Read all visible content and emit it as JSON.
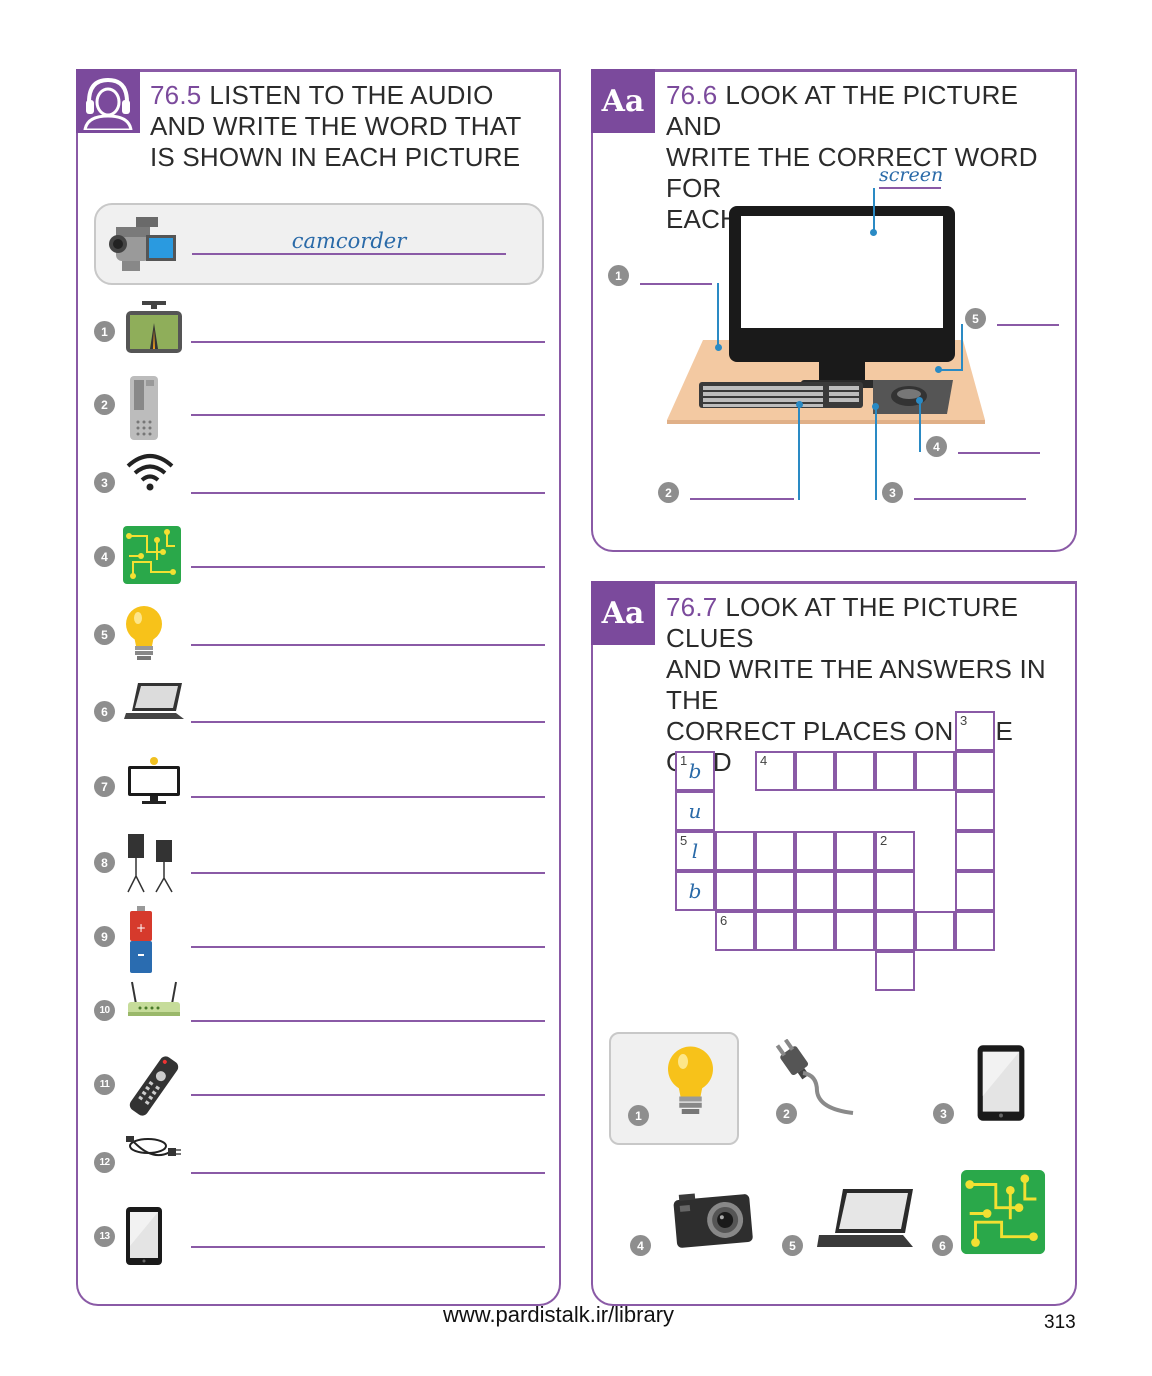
{
  "ex765": {
    "number": "76.5",
    "title": "LISTEN TO THE AUDIO AND WRITE THE WORD THAT IS SHOWN IN EACH PICTURE",
    "title_lines": [
      "LISTEN TO THE AUDIO",
      "AND WRITE THE WORD THAT",
      "IS SHOWN IN EACH PICTURE"
    ],
    "example_answer": "camcorder",
    "items": [
      {
        "n": "1",
        "icon": "sat-nav-icon"
      },
      {
        "n": "2",
        "icon": "voice-recorder-icon"
      },
      {
        "n": "3",
        "icon": "wifi-icon"
      },
      {
        "n": "4",
        "icon": "circuit-board-icon"
      },
      {
        "n": "5",
        "icon": "light-bulb-icon"
      },
      {
        "n": "6",
        "icon": "laptop-icon"
      },
      {
        "n": "7",
        "icon": "webcam-monitor-icon"
      },
      {
        "n": "8",
        "icon": "speakers-icon"
      },
      {
        "n": "9",
        "icon": "battery-icon"
      },
      {
        "n": "10",
        "icon": "router-icon"
      },
      {
        "n": "11",
        "icon": "remote-control-icon"
      },
      {
        "n": "12",
        "icon": "cable-icon"
      },
      {
        "n": "13",
        "icon": "tablet-icon"
      }
    ]
  },
  "ex766": {
    "badge": "Aa",
    "number": "76.6",
    "title_lines": [
      "LOOK AT THE PICTURE AND",
      "WRITE THE CORRECT WORD FOR",
      "EACH LABEL"
    ],
    "example_label": "screen",
    "labels": [
      "1",
      "2",
      "3",
      "4",
      "5"
    ]
  },
  "ex767": {
    "badge": "Aa",
    "number": "76.7",
    "title_lines": [
      "LOOK AT THE PICTURE CLUES",
      "AND WRITE THE ANSWERS IN THE",
      "CORRECT PLACES ON THE GRID"
    ],
    "grid_numbers": [
      "1",
      "2",
      "3",
      "4",
      "5",
      "6"
    ],
    "grid_letters": [
      "b",
      "u",
      "l",
      "b"
    ],
    "clues": [
      {
        "n": "1",
        "icon": "light-bulb-icon"
      },
      {
        "n": "2",
        "icon": "plug-icon"
      },
      {
        "n": "3",
        "icon": "tablet-icon"
      },
      {
        "n": "4",
        "icon": "camera-icon"
      },
      {
        "n": "5",
        "icon": "laptop-icon"
      },
      {
        "n": "6",
        "icon": "circuit-board-icon"
      }
    ]
  },
  "footer": {
    "url": "www.pardistalk.ir/library",
    "page_number": "313"
  },
  "colors": {
    "accent": "#7b4a9c",
    "line": "#8a5aa6",
    "handwriting": "#2a6aa8",
    "marker": "#2a8ac4"
  }
}
